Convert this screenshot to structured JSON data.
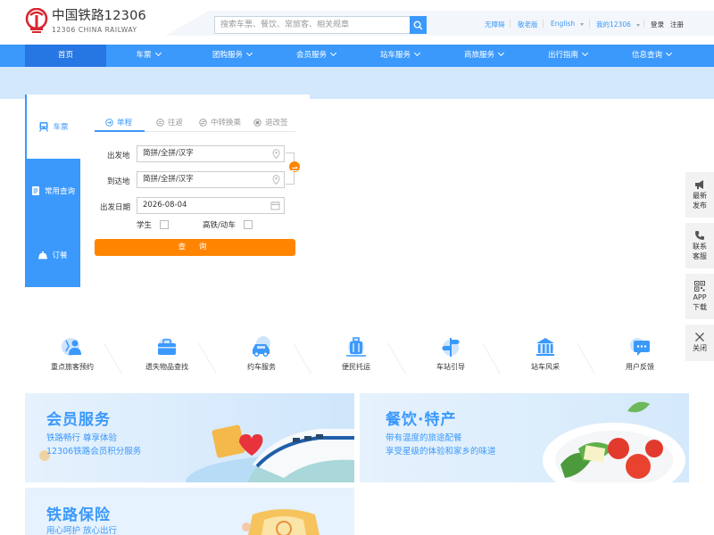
{
  "colors": {
    "brand_blue": "#3b99fc",
    "nav_active": "#2676e3",
    "orange": "#ff8400",
    "banner": "#d3e8fc",
    "logo_red": "#d6272f"
  },
  "header": {
    "logo_cn": "中国铁路12306",
    "logo_en": "12306 CHINA RAILWAY",
    "search_placeholder": "搜索车票、餐饮、常旅客、相关规章",
    "search_icon": "search-icon",
    "links": {
      "accessible": "无障碍",
      "elder": "敬老版",
      "language": "English",
      "my12306": "我的12306",
      "login": "登录",
      "register": "注册"
    }
  },
  "nav": {
    "items": [
      {
        "label": "首页",
        "has_dropdown": false
      },
      {
        "label": "车票",
        "has_dropdown": true
      },
      {
        "label": "团购服务",
        "has_dropdown": true
      },
      {
        "label": "会员服务",
        "has_dropdown": true
      },
      {
        "label": "站车服务",
        "has_dropdown": true
      },
      {
        "label": "商旅服务",
        "has_dropdown": true
      },
      {
        "label": "出行指南",
        "has_dropdown": true
      },
      {
        "label": "信息查询",
        "has_dropdown": true
      }
    ]
  },
  "booking": {
    "side_tabs": [
      {
        "label": "车票",
        "icon": "train-icon"
      },
      {
        "label": "常用查询",
        "icon": "document-icon"
      },
      {
        "label": "订餐",
        "icon": "dining-icon"
      }
    ],
    "sub_tabs": [
      "单程",
      "往返",
      "中转换乘",
      "退改签"
    ],
    "from_label": "出发地",
    "from_placeholder": "简拼/全拼/汉字",
    "to_label": "到达地",
    "to_placeholder": "简拼/全拼/汉字",
    "date_label": "出发日期",
    "date_value": "2026-08-04",
    "student_label": "学生",
    "gd_label": "高铁/动车",
    "query_label": "查 询"
  },
  "float_bar": [
    {
      "line1": "最新",
      "line2": "发布",
      "icon": "megaphone-icon"
    },
    {
      "line1": "联系",
      "line2": "客服",
      "icon": "phone-icon"
    },
    {
      "line1": "APP",
      "line2": "下载",
      "icon": "qrcode-icon"
    },
    {
      "line1": "关闭",
      "line2": "",
      "icon": "close-icon"
    }
  ],
  "services": [
    {
      "label": "重点旅客预约",
      "icon": "priority-passenger-icon"
    },
    {
      "label": "遗失物品查找",
      "icon": "lost-found-icon"
    },
    {
      "label": "约车服务",
      "icon": "car-icon"
    },
    {
      "label": "便民托运",
      "icon": "luggage-icon"
    },
    {
      "label": "车站引导",
      "icon": "signpost-icon"
    },
    {
      "label": "站车风采",
      "icon": "station-icon"
    },
    {
      "label": "用户反馈",
      "icon": "feedback-icon"
    }
  ],
  "cards": [
    {
      "title": "会员服务",
      "line1": "铁路畅行 尊享体验",
      "line2": "12306铁路会员积分服务"
    },
    {
      "title": "餐饮·特产",
      "line1": "带有温度的旅途配餐",
      "line2": "享受星级的体验和家乡的味道"
    },
    {
      "title": "铁路保险",
      "line1": "用心呵护 放心出行",
      "line2": ""
    }
  ]
}
